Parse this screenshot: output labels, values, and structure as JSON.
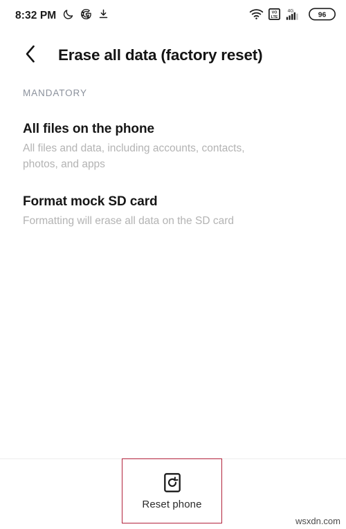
{
  "status_bar": {
    "time": "8:32 PM",
    "left_icons": [
      "moon-icon",
      "google-g-icon",
      "download-icon"
    ],
    "right_icons": [
      "wifi-icon",
      "volte-icon",
      "signal-4g-icon"
    ],
    "volte_label_top": "VO",
    "volte_label_bottom": "LTE",
    "network_label": "4G",
    "battery_percent": "96"
  },
  "app_bar": {
    "back_icon": "chevron-left-icon",
    "title": "Erase all data (factory reset)"
  },
  "content": {
    "section_header": "MANDATORY",
    "items": [
      {
        "title": "All files on the phone",
        "subtitle": "All files and data, including accounts, contacts, photos, and apps"
      },
      {
        "title": "Format mock SD card",
        "subtitle": "Formatting will erase all data on the SD card"
      }
    ]
  },
  "bottom_bar": {
    "reset_icon": "reset-circular-arrow-icon",
    "reset_label": "Reset phone"
  },
  "watermark": "wsxdn.com",
  "colors": {
    "background": "#ffffff",
    "title_text": "#141414",
    "section_header": "#8b919c",
    "item_title": "#161616",
    "item_subtitle": "#b3b3b3",
    "highlight_box": "#b2213a",
    "divider": "#ededed"
  }
}
